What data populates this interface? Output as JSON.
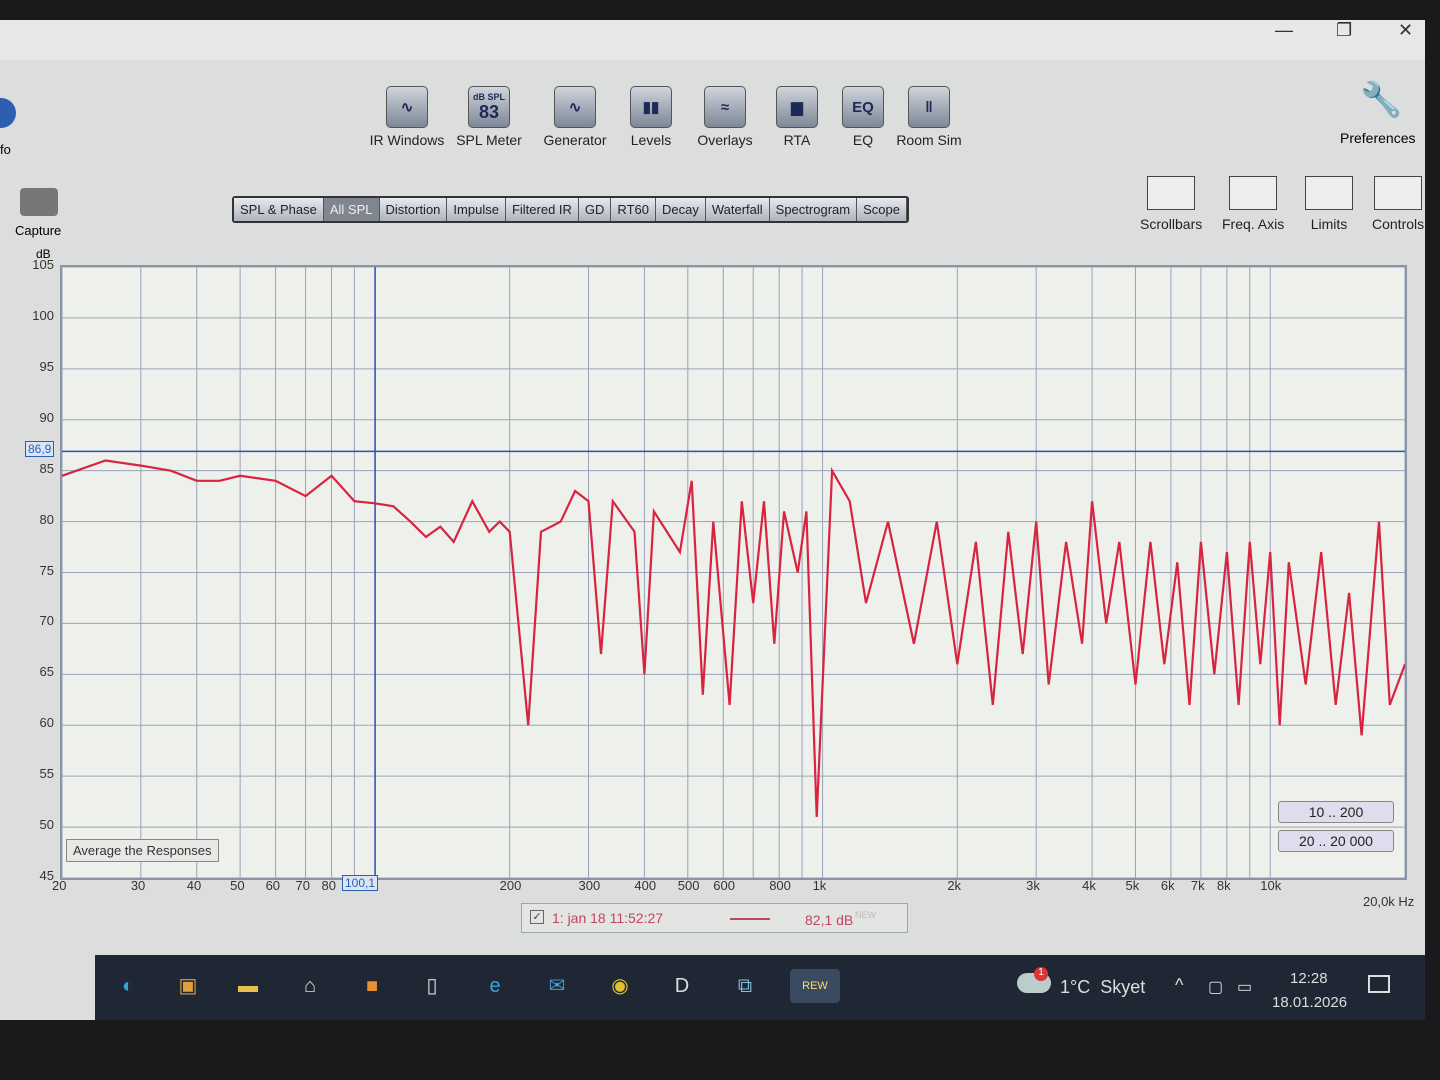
{
  "window": {
    "minimize": "—",
    "restore": "❐",
    "close": "✕"
  },
  "left": {
    "info_label": "fo",
    "capture_label": "Capture"
  },
  "toolbar": [
    {
      "label": "IR Windows",
      "icon": "ir-windows-icon",
      "glyph": "∿"
    },
    {
      "label": "SPL Meter",
      "icon": "spl-meter-icon",
      "glyph": "83",
      "sub": "dB SPL"
    },
    {
      "label": "Generator",
      "icon": "generator-icon",
      "glyph": "∿"
    },
    {
      "label": "Levels",
      "icon": "levels-icon",
      "glyph": "▮▮"
    },
    {
      "label": "Overlays",
      "icon": "overlays-icon",
      "glyph": "≈"
    },
    {
      "label": "RTA",
      "icon": "rta-icon",
      "glyph": "▆"
    },
    {
      "label": "EQ",
      "icon": "eq-icon",
      "glyph": "EQ"
    },
    {
      "label": "Room Sim",
      "icon": "room-sim-icon",
      "glyph": "‖"
    }
  ],
  "preferences_label": "Preferences",
  "tabs": [
    "SPL & Phase",
    "All SPL",
    "Distortion",
    "Impulse",
    "Filtered IR",
    "GD",
    "RT60",
    "Decay",
    "Waterfall",
    "Spectrogram",
    "Scope"
  ],
  "active_tab": "All SPL",
  "right_tools": [
    "Scrollbars",
    "Freq. Axis",
    "Limits",
    "Controls"
  ],
  "graph": {
    "y_unit": "dB",
    "cursor_y": "86,9",
    "cursor_x": "100,1",
    "avg_button": "Average the Responses",
    "range_buttons": [
      "10 .. 200",
      "20 .. 20 000"
    ],
    "x_unit": "20,0k Hz"
  },
  "legend": {
    "checked": true,
    "name": "1: jan 18 11:52:27",
    "value": "82,1 dB",
    "tag": "NEW"
  },
  "taskbar": {
    "weather": "1°C  Skyet",
    "weather_badge": "1",
    "time": "12:28",
    "date": "18.01.2026"
  },
  "chart_data": {
    "type": "line",
    "title": "All SPL",
    "xlabel": "Hz",
    "ylabel": "dB",
    "xscale": "log",
    "xlim": [
      20,
      20000
    ],
    "ylim": [
      45,
      105
    ],
    "yticks": [
      105,
      100,
      95,
      90,
      85,
      80,
      75,
      70,
      65,
      60,
      55,
      50,
      45
    ],
    "xticks": [
      {
        "v": 20,
        "l": "20"
      },
      {
        "v": 30,
        "l": "30"
      },
      {
        "v": 40,
        "l": "40"
      },
      {
        "v": 50,
        "l": "50"
      },
      {
        "v": 60,
        "l": "60"
      },
      {
        "v": 70,
        "l": "70"
      },
      {
        "v": 80,
        "l": "80"
      },
      {
        "v": 200,
        "l": "200"
      },
      {
        "v": 300,
        "l": "300"
      },
      {
        "v": 400,
        "l": "400"
      },
      {
        "v": 500,
        "l": "500"
      },
      {
        "v": 600,
        "l": "600"
      },
      {
        "v": 800,
        "l": "800"
      },
      {
        "v": 1000,
        "l": "1k"
      },
      {
        "v": 2000,
        "l": "2k"
      },
      {
        "v": 3000,
        "l": "3k"
      },
      {
        "v": 4000,
        "l": "4k"
      },
      {
        "v": 5000,
        "l": "5k"
      },
      {
        "v": 6000,
        "l": "6k"
      },
      {
        "v": 7000,
        "l": "7k"
      },
      {
        "v": 8000,
        "l": "8k"
      },
      {
        "v": 10000,
        "l": "10k"
      }
    ],
    "cursor": {
      "x": 100.1,
      "y": 86.9
    },
    "series": [
      {
        "name": "1: jan 18 11:52:27",
        "color": "#d8243f",
        "points": [
          [
            20,
            84.5
          ],
          [
            25,
            86
          ],
          [
            30,
            85.5
          ],
          [
            35,
            85
          ],
          [
            40,
            84
          ],
          [
            45,
            84
          ],
          [
            50,
            84.5
          ],
          [
            60,
            84
          ],
          [
            70,
            82.5
          ],
          [
            80,
            84.5
          ],
          [
            90,
            82
          ],
          [
            100,
            81.8
          ],
          [
            110,
            81.5
          ],
          [
            120,
            80
          ],
          [
            130,
            78.5
          ],
          [
            140,
            79.5
          ],
          [
            150,
            78
          ],
          [
            165,
            82
          ],
          [
            180,
            79
          ],
          [
            190,
            80
          ],
          [
            200,
            79
          ],
          [
            220,
            60
          ],
          [
            235,
            79
          ],
          [
            260,
            80
          ],
          [
            280,
            83
          ],
          [
            300,
            82
          ],
          [
            320,
            67
          ],
          [
            340,
            82
          ],
          [
            380,
            79
          ],
          [
            400,
            65
          ],
          [
            420,
            81
          ],
          [
            480,
            77
          ],
          [
            510,
            84
          ],
          [
            540,
            63
          ],
          [
            570,
            80
          ],
          [
            620,
            62
          ],
          [
            660,
            82
          ],
          [
            700,
            72
          ],
          [
            740,
            82
          ],
          [
            780,
            68
          ],
          [
            820,
            81
          ],
          [
            880,
            75
          ],
          [
            920,
            81
          ],
          [
            970,
            51
          ],
          [
            1050,
            85
          ],
          [
            1150,
            82
          ],
          [
            1250,
            72
          ],
          [
            1400,
            80
          ],
          [
            1600,
            68
          ],
          [
            1800,
            80
          ],
          [
            2000,
            66
          ],
          [
            2200,
            78
          ],
          [
            2400,
            62
          ],
          [
            2600,
            79
          ],
          [
            2800,
            67
          ],
          [
            3000,
            80
          ],
          [
            3200,
            64
          ],
          [
            3500,
            78
          ],
          [
            3800,
            68
          ],
          [
            4000,
            82
          ],
          [
            4300,
            70
          ],
          [
            4600,
            78
          ],
          [
            5000,
            64
          ],
          [
            5400,
            78
          ],
          [
            5800,
            66
          ],
          [
            6200,
            76
          ],
          [
            6600,
            62
          ],
          [
            7000,
            78
          ],
          [
            7500,
            65
          ],
          [
            8000,
            77
          ],
          [
            8500,
            62
          ],
          [
            9000,
            78
          ],
          [
            9500,
            66
          ],
          [
            10000,
            77
          ],
          [
            10500,
            60
          ],
          [
            11000,
            76
          ],
          [
            12000,
            64
          ],
          [
            13000,
            77
          ],
          [
            14000,
            62
          ],
          [
            15000,
            73
          ],
          [
            16000,
            59
          ],
          [
            17500,
            80
          ],
          [
            18500,
            62
          ],
          [
            20000,
            66
          ]
        ]
      }
    ]
  }
}
